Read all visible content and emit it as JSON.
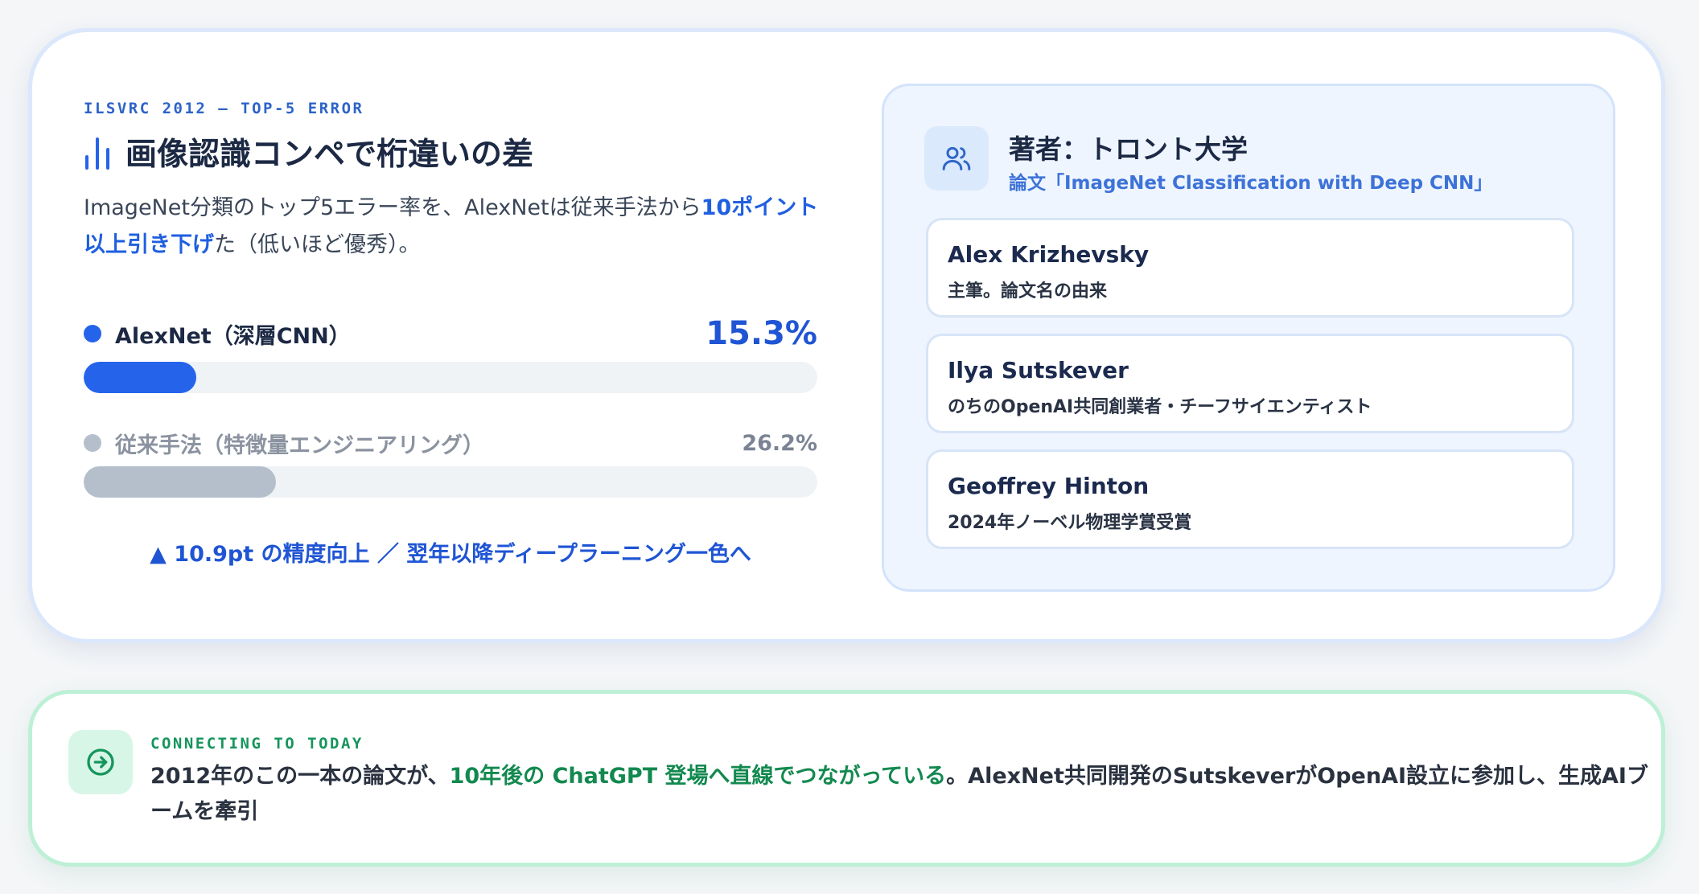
{
  "chart_data": {
    "type": "bar",
    "orientation": "horizontal",
    "eyebrow": "ILSVRC 2012 — TOP-5 ERROR",
    "title": "画像認識コンペで桁違いの差",
    "description_before": "ImageNet分類のトップ5エラー率を、AlexNetは従来手法から",
    "description_highlight": "10ポイント以上引き下げ",
    "description_after": "た（低いほど優秀）。",
    "unit": "%",
    "xlim": [
      0,
      100
    ],
    "series": [
      {
        "name": "AlexNet（深層CNN）",
        "value": 15.3,
        "label": "15.3%",
        "color": "#2563eb"
      },
      {
        "name": "従来手法（特徴量エンジニアリング）",
        "value": 26.2,
        "label": "26.2%",
        "color": "#b5bfcc"
      }
    ],
    "annotation": "▲ 10.9pt の精度向上 ／ 翌年以降ディープラーニング一色へ"
  },
  "authors": {
    "title": "著者：トロント大学",
    "subtitle": "論文「ImageNet Classification with Deep CNN」",
    "icon": "users-icon",
    "items": [
      {
        "name": "Alex Krizhevsky",
        "role": "主筆。論文名の由来"
      },
      {
        "name": "Ilya Sutskever",
        "role": "のちのOpenAI共同創業者・チーフサイエンティスト"
      },
      {
        "name": "Geoffrey Hinton",
        "role": "2024年ノーベル物理学賞受賞"
      }
    ]
  },
  "connecting": {
    "eyebrow": "CONNECTING TO TODAY",
    "icon": "arrow-right-circle-icon",
    "text_before": "2012年のこの一本の論文が、",
    "text_highlight": "10年後の ChatGPT 登場へ直線でつながっている",
    "text_after": "。AlexNet共同開発のSutskeverがOpenAI設立に参加し、生成AIブームを牽引"
  },
  "colors": {
    "accent": "#2563eb",
    "muted_bar": "#b5bfcc",
    "green_accent": "#12894f",
    "panel_bg": "#eef5ff"
  }
}
